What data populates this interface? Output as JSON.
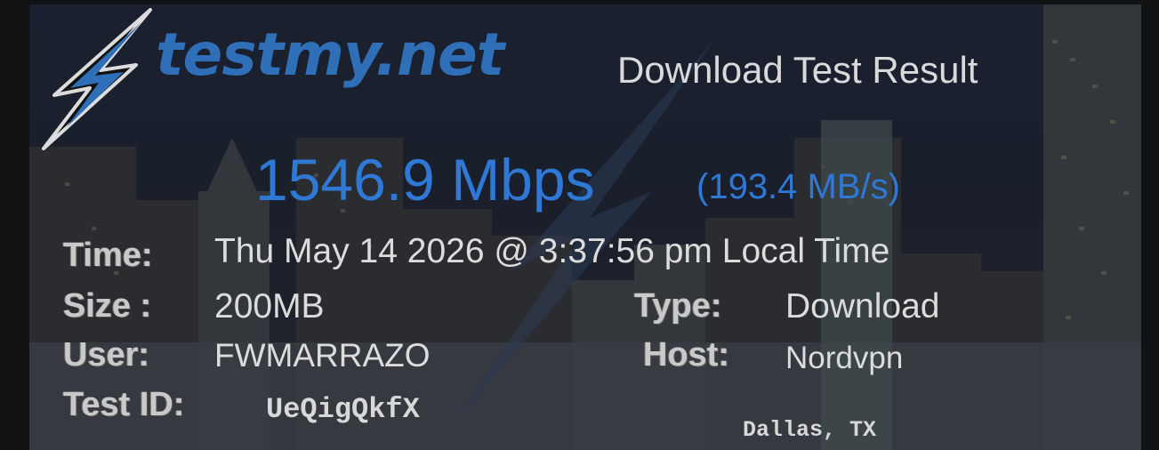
{
  "brand": {
    "name": "testmy.net"
  },
  "header": {
    "title": "Download Test Result"
  },
  "speed": {
    "mbps": "1546.9 Mbps",
    "mbs": "(193.4 MB/s)"
  },
  "details": {
    "time_label": "Time:",
    "time_value": "Thu May 14 2026 @ 3:37:56 pm Local Time",
    "size_label": "Size :",
    "size_value": "200MB",
    "type_label": "Type:",
    "type_value": "Download",
    "user_label": "User:",
    "user_value": "FWMARRAZO",
    "host_label": "Host:",
    "host_value": "Nordvpn",
    "testid_label": "Test ID:",
    "testid_value": "UeQigQkfX",
    "location": "Dallas, TX"
  },
  "colors": {
    "brand_blue": "#2e6fb8",
    "speed_blue": "#2f78d6",
    "label_gray": "#c9c9c9",
    "value_gray": "#dcdcdc"
  },
  "icons": {
    "logo": "lightning-bolt-icon"
  }
}
